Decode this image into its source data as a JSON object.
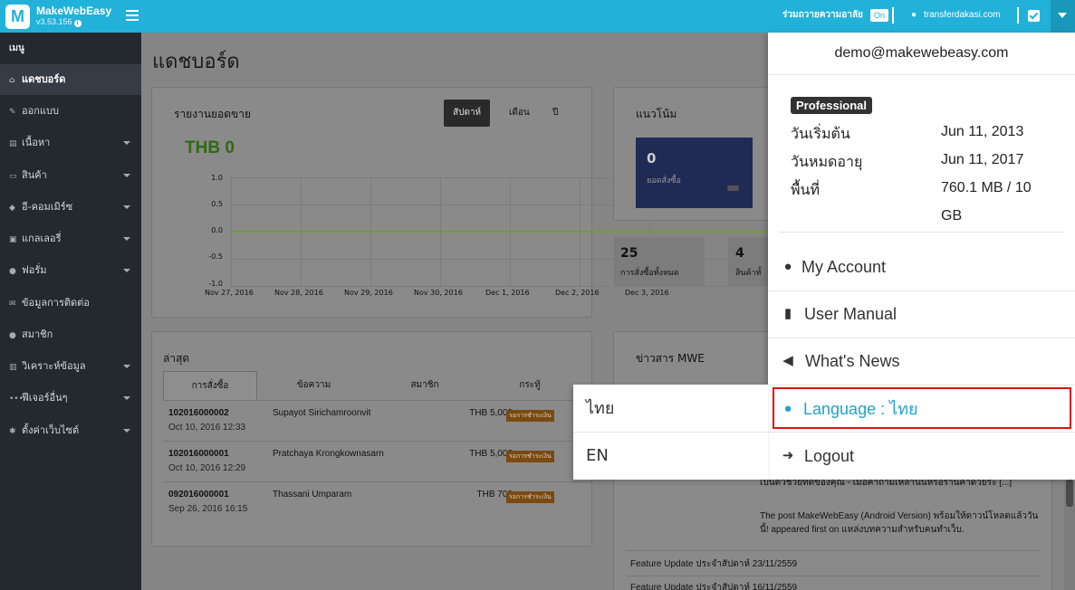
{
  "topbar": {
    "brand": "MakeWebEasy",
    "version": "v3.53.156",
    "logo_letter": "M",
    "charity_label": "ร่วมถวายความอาลัย",
    "charity_toggle": "On",
    "domain": "transferdakasi.com"
  },
  "sidebar": {
    "menu_title": "เมนู",
    "items": [
      {
        "label": "แดชบอร์ด",
        "icon": "home-icon",
        "active": true
      },
      {
        "label": "ออกแบบ",
        "icon": "brush-icon"
      },
      {
        "label": "เนื้อหา",
        "icon": "file-icon",
        "has_sub": true
      },
      {
        "label": "สินค้า",
        "icon": "cart-icon",
        "has_sub": true
      },
      {
        "label": "อี-คอมเมิร์ซ",
        "icon": "tag-icon",
        "has_sub": true
      },
      {
        "label": "แกลเลอรี่",
        "icon": "image-icon",
        "has_sub": true
      },
      {
        "label": "ฟอรั่ม",
        "icon": "comments-icon",
        "has_sub": true
      },
      {
        "label": "ข้อมูลการติดต่อ",
        "icon": "envelope-icon"
      },
      {
        "label": "สมาชิก",
        "icon": "users-icon"
      },
      {
        "label": "วิเคราะห์ข้อมูล",
        "icon": "chart-icon",
        "has_sub": true
      },
      {
        "label": "ฟีเจอร์อื่นๆ",
        "icon": "ellipsis-icon",
        "has_sub": true
      },
      {
        "label": "ตั้งค่าเว็บไซต์",
        "icon": "gear-icon",
        "has_sub": true
      }
    ]
  },
  "main": {
    "page_title": "แดชบอร์ด",
    "sales": {
      "title": "รายงานยอดขาย",
      "tabs": [
        "สัปดาห์",
        "เดือน",
        "ปี"
      ],
      "total": "THB 0"
    },
    "trend": {
      "title": "แนวโน้ม",
      "order_count": "0",
      "order_label": "ยอดสั่งซื้อ",
      "stat1_value": "25",
      "stat1_label": "การสั่งซื้อทั้งหมด",
      "stat2_value": "4",
      "stat2_label": "สินค้าทั้"
    },
    "latest": {
      "title": "ล่าสุด",
      "tabs": [
        "การสั่งซื้อ",
        "ข้อความ",
        "สมาชิก",
        "กระทู้"
      ],
      "orders": [
        {
          "id": "102016000002",
          "date": "Oct 10, 2016 12:33",
          "name": "Supayot Sirichamroonvit",
          "amount": "THB 5,000",
          "status": "รอการชำระเงิน"
        },
        {
          "id": "102016000001",
          "date": "Oct 10, 2016 12:29",
          "name": "Pratchaya Krongkownasarn",
          "amount": "THB 5,000",
          "status": "รอการชำระเงิน"
        },
        {
          "id": "092016000001",
          "date": "Sep 26, 2016 16:15",
          "name": "Thassani Umparam",
          "amount": "THB 700",
          "status": "รอการชำระเงิน"
        }
      ]
    },
    "news": {
      "title": "ข่าวสาร MWE",
      "snippet1": "เป็นตัวช่วยที่ดีของคุณ - เมื่อคำถามเหล่านั้นหรือร้านค้าด้วยระ [...]",
      "snippet2": "The post MakeWebEasy (Android Version) พร้อมให้ดาวน์โหลดแล้ววันนี้! appeared first on แหล่งบทความสำหรับคนทำเว็บ.",
      "item1": "Feature Update ประจำสัปดาห์ 23/11/2559",
      "item2": "Feature Update ประจำสัปดาห์ 16/11/2559"
    }
  },
  "chart_data": {
    "type": "line",
    "title": "",
    "x": [
      "Nov 27, 2016",
      "Nov 28, 2016",
      "Nov 29, 2016",
      "Nov 30, 2016",
      "Dec 1, 2016",
      "Dec 2, 2016",
      "Dec 3, 2016"
    ],
    "series": [
      {
        "values": [
          0,
          0,
          0,
          0,
          0,
          0,
          0
        ],
        "color": "#6e9f24"
      }
    ],
    "yticks": [
      "1.0",
      "0.5",
      "0.0",
      "-0.5",
      "-1.0"
    ],
    "ylim": [
      -1.0,
      1.0
    ],
    "grid": true
  },
  "account_menu": {
    "email": "demo@makewebeasy.com",
    "plan": "Professional",
    "start_label": "วันเริ่มต้น",
    "start_value": "Jun 11, 2013",
    "expire_label": "วันหมดอายุ",
    "expire_value": "Jun 11, 2017",
    "space_label": "พื้นที่",
    "space_value": "760.1 MB / 10 GB",
    "items": [
      {
        "label": "My Account",
        "icon": "user-icon"
      },
      {
        "label": "User Manual",
        "icon": "book-icon"
      },
      {
        "label": "What's News",
        "icon": "megaphone-icon"
      },
      {
        "label": "Language : ไทย",
        "icon": "globe-icon"
      },
      {
        "label": "Logout",
        "icon": "sign-out-icon"
      }
    ]
  },
  "language_menu": {
    "options": [
      "ไทย",
      "EN"
    ]
  }
}
